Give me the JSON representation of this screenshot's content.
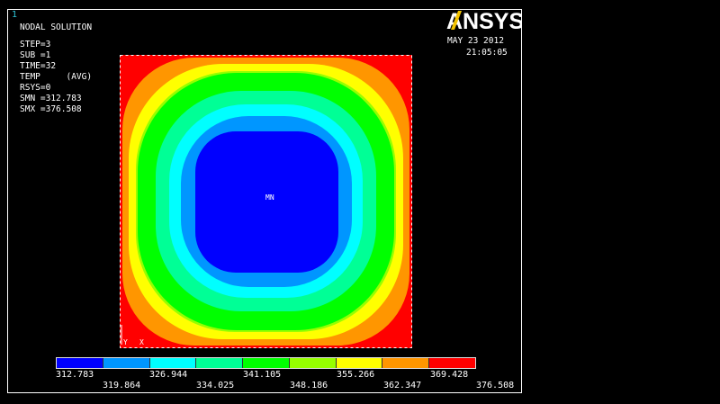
{
  "window": {
    "number": "1"
  },
  "info": {
    "title": "NODAL SOLUTION",
    "step": "STEP=3",
    "sub": "SUB =1",
    "time": "TIME=32",
    "temp": "TEMP     (AVG)",
    "rsys": "RSYS=0",
    "smn": "SMN =312.783",
    "smx": "SMX =376.508"
  },
  "logo": {
    "text": "ANSYS"
  },
  "datetime": {
    "date": "MAY 23 2012",
    "time": "21:05:05"
  },
  "plot": {
    "min_label": "MN",
    "axis_label": "X",
    "contour_colors": [
      "#0000ff",
      "#0096ff",
      "#00ffff",
      "#00ff96",
      "#00ff00",
      "#96ff00",
      "#ffff00",
      "#ff9600",
      "#ff0000"
    ]
  },
  "legend": {
    "colors": [
      "#0000ff",
      "#0096ff",
      "#00ffff",
      "#00ff96",
      "#00ff00",
      "#96ff00",
      "#ffff00",
      "#ff9600",
      "#ff0000"
    ],
    "values": [
      "312.783",
      "319.864",
      "326.944",
      "334.025",
      "341.105",
      "348.186",
      "355.266",
      "362.347",
      "369.428",
      "376.508"
    ]
  }
}
